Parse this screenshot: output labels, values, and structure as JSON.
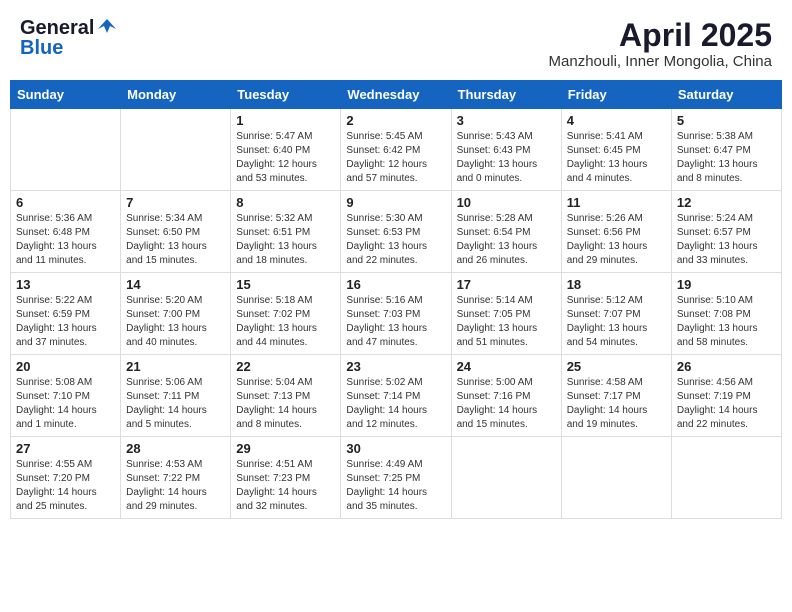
{
  "header": {
    "logo_general": "General",
    "logo_blue": "Blue",
    "month": "April 2025",
    "location": "Manzhouli, Inner Mongolia, China"
  },
  "days_of_week": [
    "Sunday",
    "Monday",
    "Tuesday",
    "Wednesday",
    "Thursday",
    "Friday",
    "Saturday"
  ],
  "weeks": [
    [
      {
        "day": "",
        "info": ""
      },
      {
        "day": "",
        "info": ""
      },
      {
        "day": "1",
        "info": "Sunrise: 5:47 AM\nSunset: 6:40 PM\nDaylight: 12 hours\nand 53 minutes."
      },
      {
        "day": "2",
        "info": "Sunrise: 5:45 AM\nSunset: 6:42 PM\nDaylight: 12 hours\nand 57 minutes."
      },
      {
        "day": "3",
        "info": "Sunrise: 5:43 AM\nSunset: 6:43 PM\nDaylight: 13 hours\nand 0 minutes."
      },
      {
        "day": "4",
        "info": "Sunrise: 5:41 AM\nSunset: 6:45 PM\nDaylight: 13 hours\nand 4 minutes."
      },
      {
        "day": "5",
        "info": "Sunrise: 5:38 AM\nSunset: 6:47 PM\nDaylight: 13 hours\nand 8 minutes."
      }
    ],
    [
      {
        "day": "6",
        "info": "Sunrise: 5:36 AM\nSunset: 6:48 PM\nDaylight: 13 hours\nand 11 minutes."
      },
      {
        "day": "7",
        "info": "Sunrise: 5:34 AM\nSunset: 6:50 PM\nDaylight: 13 hours\nand 15 minutes."
      },
      {
        "day": "8",
        "info": "Sunrise: 5:32 AM\nSunset: 6:51 PM\nDaylight: 13 hours\nand 18 minutes."
      },
      {
        "day": "9",
        "info": "Sunrise: 5:30 AM\nSunset: 6:53 PM\nDaylight: 13 hours\nand 22 minutes."
      },
      {
        "day": "10",
        "info": "Sunrise: 5:28 AM\nSunset: 6:54 PM\nDaylight: 13 hours\nand 26 minutes."
      },
      {
        "day": "11",
        "info": "Sunrise: 5:26 AM\nSunset: 6:56 PM\nDaylight: 13 hours\nand 29 minutes."
      },
      {
        "day": "12",
        "info": "Sunrise: 5:24 AM\nSunset: 6:57 PM\nDaylight: 13 hours\nand 33 minutes."
      }
    ],
    [
      {
        "day": "13",
        "info": "Sunrise: 5:22 AM\nSunset: 6:59 PM\nDaylight: 13 hours\nand 37 minutes."
      },
      {
        "day": "14",
        "info": "Sunrise: 5:20 AM\nSunset: 7:00 PM\nDaylight: 13 hours\nand 40 minutes."
      },
      {
        "day": "15",
        "info": "Sunrise: 5:18 AM\nSunset: 7:02 PM\nDaylight: 13 hours\nand 44 minutes."
      },
      {
        "day": "16",
        "info": "Sunrise: 5:16 AM\nSunset: 7:03 PM\nDaylight: 13 hours\nand 47 minutes."
      },
      {
        "day": "17",
        "info": "Sunrise: 5:14 AM\nSunset: 7:05 PM\nDaylight: 13 hours\nand 51 minutes."
      },
      {
        "day": "18",
        "info": "Sunrise: 5:12 AM\nSunset: 7:07 PM\nDaylight: 13 hours\nand 54 minutes."
      },
      {
        "day": "19",
        "info": "Sunrise: 5:10 AM\nSunset: 7:08 PM\nDaylight: 13 hours\nand 58 minutes."
      }
    ],
    [
      {
        "day": "20",
        "info": "Sunrise: 5:08 AM\nSunset: 7:10 PM\nDaylight: 14 hours\nand 1 minute."
      },
      {
        "day": "21",
        "info": "Sunrise: 5:06 AM\nSunset: 7:11 PM\nDaylight: 14 hours\nand 5 minutes."
      },
      {
        "day": "22",
        "info": "Sunrise: 5:04 AM\nSunset: 7:13 PM\nDaylight: 14 hours\nand 8 minutes."
      },
      {
        "day": "23",
        "info": "Sunrise: 5:02 AM\nSunset: 7:14 PM\nDaylight: 14 hours\nand 12 minutes."
      },
      {
        "day": "24",
        "info": "Sunrise: 5:00 AM\nSunset: 7:16 PM\nDaylight: 14 hours\nand 15 minutes."
      },
      {
        "day": "25",
        "info": "Sunrise: 4:58 AM\nSunset: 7:17 PM\nDaylight: 14 hours\nand 19 minutes."
      },
      {
        "day": "26",
        "info": "Sunrise: 4:56 AM\nSunset: 7:19 PM\nDaylight: 14 hours\nand 22 minutes."
      }
    ],
    [
      {
        "day": "27",
        "info": "Sunrise: 4:55 AM\nSunset: 7:20 PM\nDaylight: 14 hours\nand 25 minutes."
      },
      {
        "day": "28",
        "info": "Sunrise: 4:53 AM\nSunset: 7:22 PM\nDaylight: 14 hours\nand 29 minutes."
      },
      {
        "day": "29",
        "info": "Sunrise: 4:51 AM\nSunset: 7:23 PM\nDaylight: 14 hours\nand 32 minutes."
      },
      {
        "day": "30",
        "info": "Sunrise: 4:49 AM\nSunset: 7:25 PM\nDaylight: 14 hours\nand 35 minutes."
      },
      {
        "day": "",
        "info": ""
      },
      {
        "day": "",
        "info": ""
      },
      {
        "day": "",
        "info": ""
      }
    ]
  ]
}
